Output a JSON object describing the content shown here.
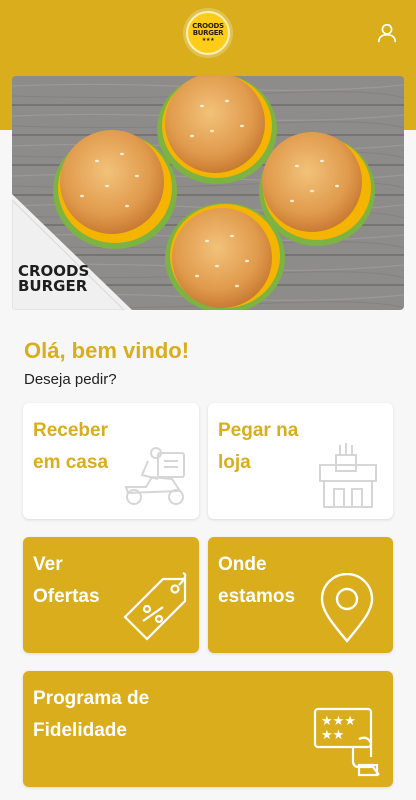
{
  "header": {
    "logo_text_line1": "CROODS",
    "logo_text_line2": "BURGER",
    "logo_stars": "★★★",
    "user_icon": "user-icon",
    "brand_color": "#d9ad1b"
  },
  "hero": {
    "logo_line1": "CROODS",
    "logo_line2": "BURGER"
  },
  "welcome": {
    "title": "Olá, bem vindo!",
    "subtitle": "Deseja pedir?"
  },
  "cards": {
    "delivery": {
      "label": "Receber\nem casa",
      "icon": "delivery-scooter-icon"
    },
    "pickup": {
      "label": "Pegar na\nloja",
      "icon": "store-pickup-icon"
    },
    "offers": {
      "label": "Ver\nOfertas",
      "icon": "discount-tag-icon"
    },
    "locations": {
      "label": "Onde\nestamos",
      "icon": "map-pin-icon"
    },
    "loyalty": {
      "label": "Programa de\nFidelidade",
      "icon": "loyalty-card-icon"
    }
  }
}
